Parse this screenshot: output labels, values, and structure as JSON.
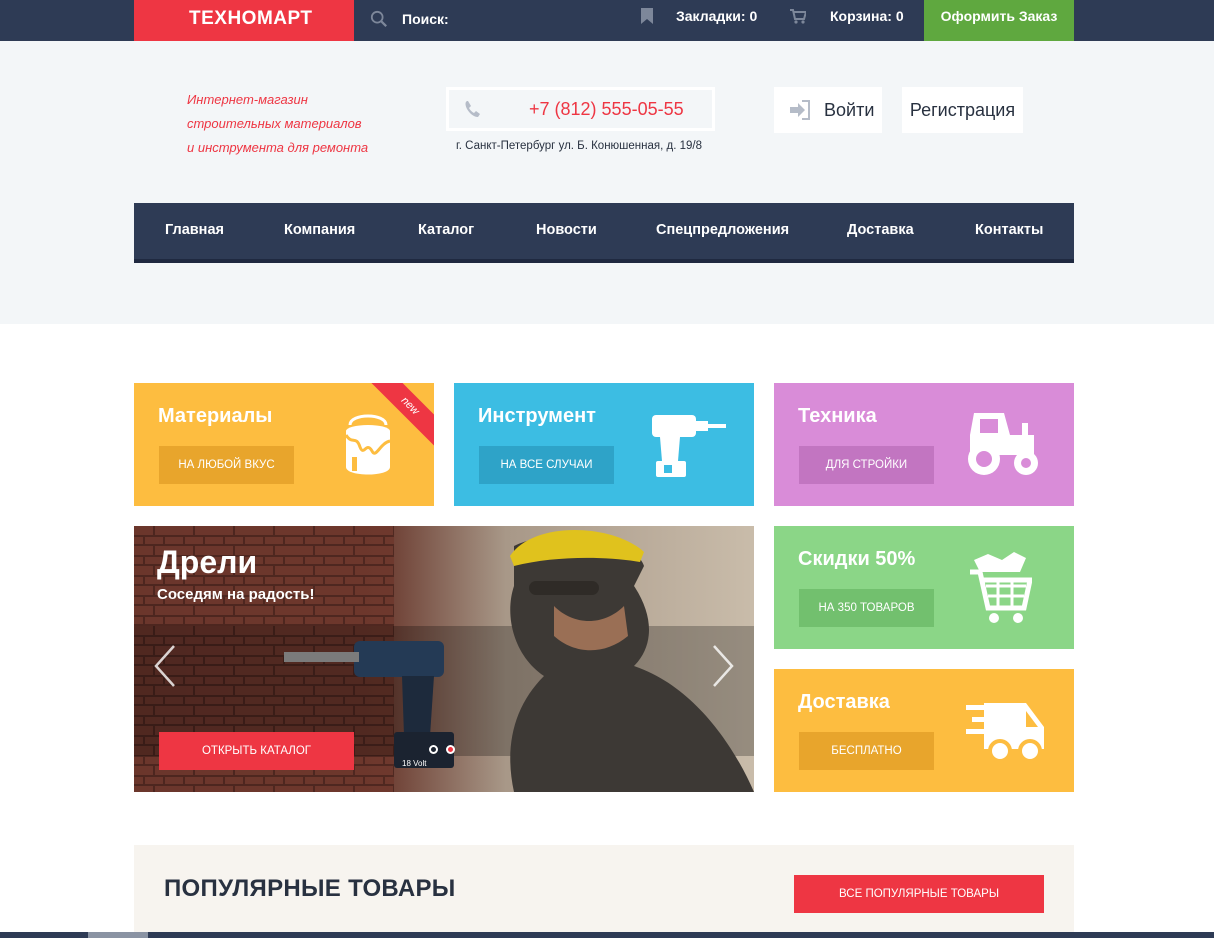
{
  "topbar": {
    "logo": "ТЕХНОМАРТ",
    "search_label": "Поиск:",
    "bookmarks_label": "Закладки: 0",
    "cart_label": "Корзина: 0",
    "order_button": "Оформить Заказ"
  },
  "header": {
    "tagline_lines": [
      "Интернет-магазин",
      "строительных материалов",
      "и инструмента для ремонта"
    ],
    "phone": "+7 (812) 555-05-55",
    "address": "г. Санкт-Петербург ул. Б. Конюшенная, д. 19/8",
    "login": "Войти",
    "register": "Регистрация"
  },
  "nav": {
    "items": [
      "Главная",
      "Компания",
      "Каталог",
      "Новости",
      "Спецпредложения",
      "Доставка",
      "Контакты"
    ]
  },
  "tiles": {
    "materials": {
      "title": "Материалы",
      "button": "НА ЛЮБОЙ ВКУС",
      "badge": "new",
      "color": "#fdbd40"
    },
    "tools": {
      "title": "Инструмент",
      "button": "НА ВСЕ СЛУЧАИ",
      "color": "#3cbde3"
    },
    "machinery": {
      "title": "Техника",
      "button": "ДЛЯ СТРОЙКИ",
      "color": "#d98cd8"
    },
    "discount": {
      "title": "Скидки 50%",
      "button": "НА 350 ТОВАРОВ",
      "color": "#8bd687"
    },
    "delivery": {
      "title": "Доставка",
      "button": "БЕСПЛАТНО",
      "color": "#fdbd40"
    }
  },
  "slider": {
    "title": "Дрели",
    "subtitle": "Соседям на радость!",
    "button": "ОТКРЫТЬ КАТАЛОГ",
    "battery_label": "18 Volt"
  },
  "popular": {
    "title": "ПОПУЛЯРНЫЕ ТОВАРЫ",
    "button": "ВСЕ ПОПУЛЯРНЫЕ ТОВАРЫ"
  },
  "colors": {
    "accent_red": "#ee3643",
    "navy": "#2e3b55",
    "green": "#5fa83f"
  }
}
